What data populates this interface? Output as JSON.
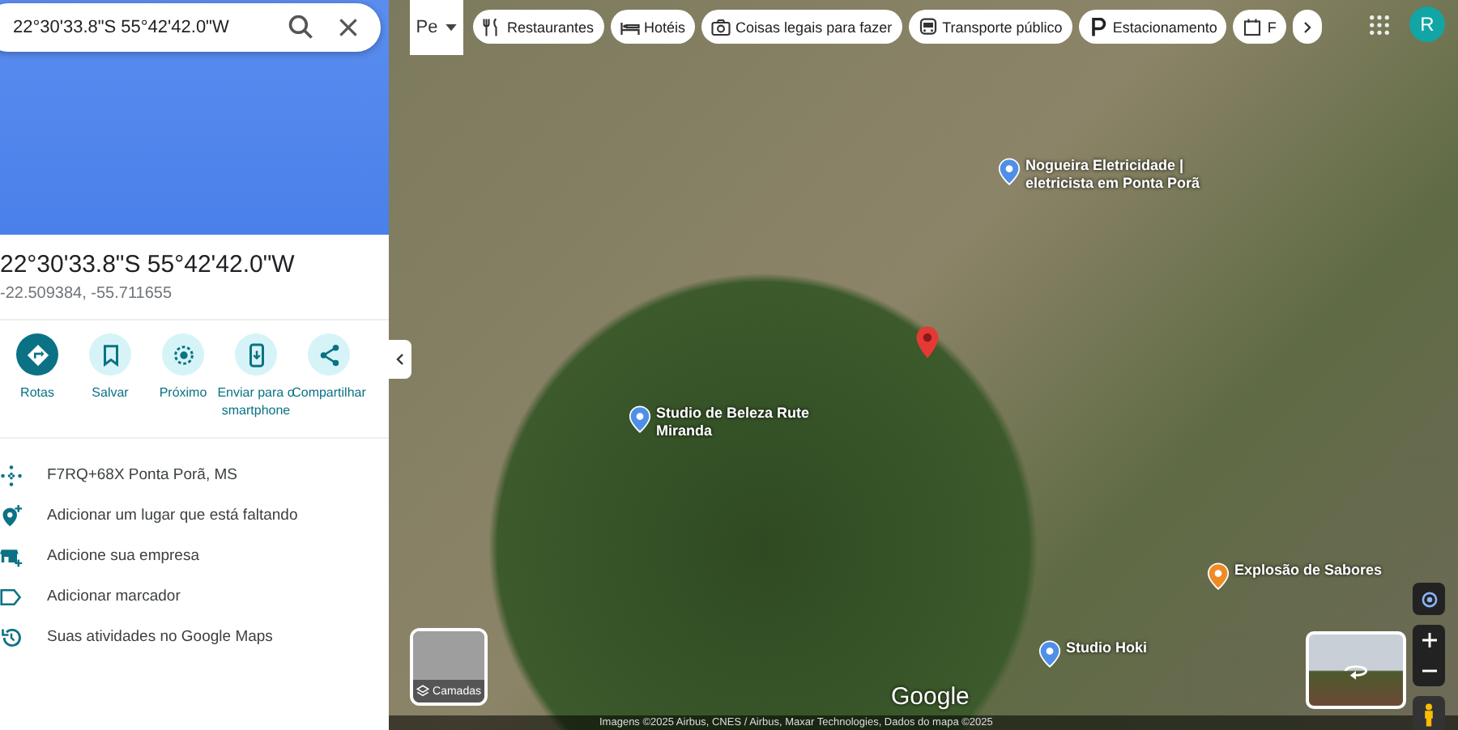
{
  "search": {
    "value": "22°30'33.8\"S 55°42'42.0\"W"
  },
  "place": {
    "title": "22°30'33.8\"S 55°42'42.0\"W",
    "coordinates": "-22.509384, -55.711655"
  },
  "actions": [
    {
      "kind": "routes",
      "label": "Rotas",
      "selected": true
    },
    {
      "kind": "save",
      "label": "Salvar",
      "selected": false
    },
    {
      "kind": "nearby",
      "label": "Próximo",
      "selected": false
    },
    {
      "kind": "send",
      "label": "Enviar para o smartphone",
      "selected": false
    },
    {
      "kind": "share",
      "label": "Compartilhar",
      "selected": false
    }
  ],
  "details": [
    {
      "kind": "pluscode",
      "text": "F7RQ+68X Ponta Porã, MS"
    },
    {
      "kind": "addplace",
      "text": "Adicionar um lugar que está faltando"
    },
    {
      "kind": "business",
      "text": "Adicione sua empresa"
    },
    {
      "kind": "label",
      "text": "Adicionar marcador"
    },
    {
      "kind": "history",
      "text": "Suas atividades no Google Maps"
    }
  ],
  "map": {
    "type_selector": "Pe",
    "chips": [
      {
        "kind": "food",
        "label": "Restaurantes"
      },
      {
        "kind": "hotel",
        "label": "Hotéis"
      },
      {
        "kind": "camera",
        "label": "Coisas legais para fazer"
      },
      {
        "kind": "transit",
        "label": "Transporte público"
      },
      {
        "kind": "parking",
        "label": "Estacionamento"
      },
      {
        "kind": "more",
        "label": "F"
      }
    ],
    "account_initial": "R",
    "places": [
      {
        "name": "Nogueira Eletricidade | eletricista em Ponta Porã",
        "kind": "service"
      },
      {
        "name": "Studio de Beleza Rute Miranda",
        "kind": "service"
      },
      {
        "name": "Explosão de Sabores",
        "kind": "food"
      },
      {
        "name": "Studio Hoki",
        "kind": "service"
      }
    ],
    "layers_label": "Camadas",
    "logo": "Google",
    "footer": "Imagens ©2025 Airbus, CNES / Airbus, Maxar Technologies, Dados do mapa ©2025"
  }
}
